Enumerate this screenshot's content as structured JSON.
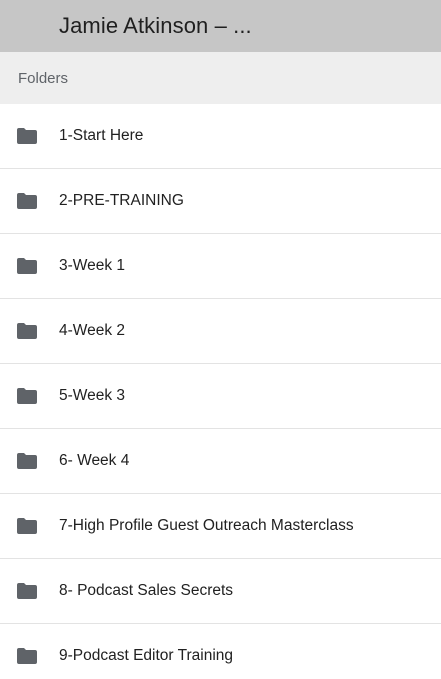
{
  "header": {
    "title": "Jamie Atkinson – ..."
  },
  "section": {
    "label": "Folders"
  },
  "folders": [
    {
      "label": "1-Start Here",
      "icon": "folder-icon"
    },
    {
      "label": "2-PRE-TRAINING",
      "icon": "folder-icon"
    },
    {
      "label": "3-Week 1",
      "icon": "folder-icon"
    },
    {
      "label": "4-Week 2",
      "icon": "folder-icon"
    },
    {
      "label": "5-Week 3",
      "icon": "folder-icon"
    },
    {
      "label": "6- Week 4",
      "icon": "folder-icon"
    },
    {
      "label": "7-High Profile Guest Outreach Masterclass",
      "icon": "folder-icon"
    },
    {
      "label": "8- Podcast Sales Secrets",
      "icon": "folder-icon"
    },
    {
      "label": "9-Podcast Editor Training",
      "icon": "folder-icon"
    }
  ],
  "colors": {
    "header_bg": "#c6c6c6",
    "section_bg": "#eeeeee",
    "icon": "#5f6368"
  }
}
